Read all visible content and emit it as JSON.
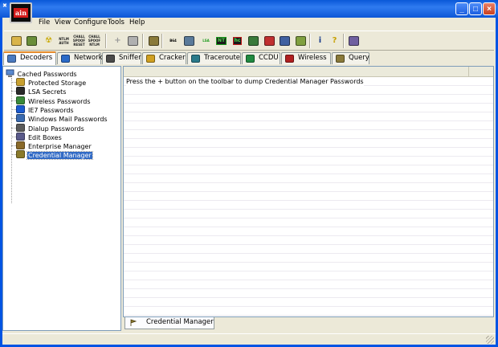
{
  "window": {
    "logo_text": "ain",
    "buttons": {
      "minimize": "_",
      "maximize": "□",
      "close": "×"
    }
  },
  "menu": [
    "File",
    "View",
    "Configure",
    "Tools",
    "Help"
  ],
  "toolbar": {
    "icons": [
      {
        "name": "start-sniffer-icon",
        "glyph": "",
        "color": "#d9b44a"
      },
      {
        "name": "start-arp-icon",
        "glyph": "",
        "color": "#6a8e3a"
      },
      {
        "name": "radiation-icon",
        "glyph": "☢",
        "color": "#c9a800"
      },
      {
        "name": "ntlm-auth-icon",
        "glyph": "NTLM AUTH",
        "color": "#202020"
      },
      {
        "name": "chall-spoof-reset-icon",
        "glyph": "CHALL SPOOF RESET",
        "color": "#202020"
      },
      {
        "name": "chall-spoof-ntlm-icon",
        "glyph": "CHALL SPOOF NTLM",
        "color": "#202020"
      },
      {
        "name": "add-icon",
        "glyph": "+",
        "color": "#9a9a9a"
      },
      {
        "name": "remove-icon",
        "glyph": "",
        "color": "#b0b0b0"
      },
      {
        "name": "test-password-icon",
        "glyph": "",
        "color": "#8a7a3a"
      },
      {
        "name": "base64-icon",
        "glyph": "B64",
        "color": "#000000"
      },
      {
        "name": "wand-icon",
        "glyph": "",
        "color": "#5a7a9a"
      },
      {
        "name": "lsa-icon",
        "glyph": "LSA",
        "color": "#1a9a1a"
      },
      {
        "name": "ntlm-hash-icon",
        "glyph": "NT",
        "color": "#1a9a1a"
      },
      {
        "name": "hash-calc-icon",
        "glyph": "hc",
        "color": "#c01a1a"
      },
      {
        "name": "terminal-icon",
        "glyph": "",
        "color": "#3a7a3a"
      },
      {
        "name": "monitor-icon",
        "glyph": "",
        "color": "#c03030"
      },
      {
        "name": "voip-icon",
        "glyph": "",
        "color": "#4060a0"
      },
      {
        "name": "route-icon",
        "glyph": "",
        "color": "#80a040"
      },
      {
        "name": "about-icon",
        "glyph": "i",
        "color": "#1a3c8a"
      },
      {
        "name": "help-icon",
        "glyph": "?",
        "color": "#c8a000"
      },
      {
        "name": "exit-icon",
        "glyph": "",
        "color": "#7060a0"
      }
    ]
  },
  "tabs": [
    {
      "label": "Decoders",
      "icon": "decoders-icon",
      "color": "#4a7ac0"
    },
    {
      "label": "Network",
      "icon": "network-icon",
      "color": "#2a6ac8"
    },
    {
      "label": "Sniffer",
      "icon": "sniffer-icon",
      "color": "#4a4a4a"
    },
    {
      "label": "Cracker",
      "icon": "cracker-icon",
      "color": "#d0a020"
    },
    {
      "label": "Traceroute",
      "icon": "traceroute-icon",
      "color": "#2a7a8a"
    },
    {
      "label": "CCDU",
      "icon": "ccdu-icon",
      "color": "#208a40"
    },
    {
      "label": "Wireless",
      "icon": "wireless-icon",
      "color": "#b02020"
    },
    {
      "label": "Query",
      "icon": "query-icon",
      "color": "#8a7a3a"
    }
  ],
  "tree": {
    "root": "Cached Passwords",
    "items": [
      {
        "label": "Protected Storage",
        "icon": "protected-storage-icon",
        "color": "#c8a030"
      },
      {
        "label": "LSA Secrets",
        "icon": "lsa-secrets-icon",
        "color": "#2a2a2a"
      },
      {
        "label": "Wireless Passwords",
        "icon": "wireless-passwords-icon",
        "color": "#3a8a3a"
      },
      {
        "label": "IE7 Passwords",
        "icon": "ie7-icon",
        "color": "#1a5ad0"
      },
      {
        "label": "Windows Mail Passwords",
        "icon": "windows-mail-icon",
        "color": "#3a6ab0"
      },
      {
        "label": "Dialup Passwords",
        "icon": "dialup-icon",
        "color": "#5a5a5a"
      },
      {
        "label": "Edit Boxes",
        "icon": "edit-boxes-icon",
        "color": "#5a5a8a"
      },
      {
        "label": "Enterprise Manager",
        "icon": "enterprise-manager-icon",
        "color": "#8a6a2a"
      },
      {
        "label": "Credential Manager",
        "icon": "credential-manager-icon",
        "color": "#8a7a2a",
        "selected": true
      }
    ]
  },
  "listview": {
    "message": "Press the + button on the toolbar to dump Credential Manager Passwords"
  },
  "bottom_tab": {
    "label": "Credential Manager",
    "color": "#8a7a2a"
  }
}
